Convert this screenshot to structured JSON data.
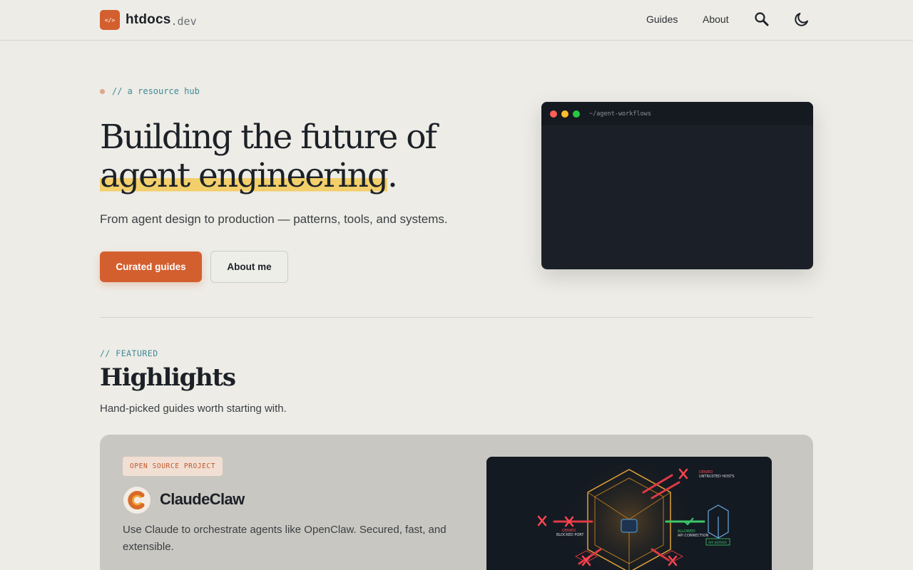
{
  "nav": {
    "logo_icon": "code-brackets-icon",
    "logo_glyph": "</>",
    "site_name": "htdocs",
    "site_tld": ".dev",
    "links": [
      {
        "label": "Guides"
      },
      {
        "label": "About"
      }
    ],
    "icons": [
      "search-icon",
      "moon-icon"
    ]
  },
  "hero": {
    "eyebrow": "// a resource hub",
    "title_line1": "Building the future of",
    "title_highlight": "agent engineering",
    "title_end": ".",
    "subtitle": "From agent design to production — patterns, tools, and systems.",
    "primary_cta": "Curated guides",
    "secondary_cta": "About me",
    "terminal_path": "~/agent-workflows"
  },
  "featured": {
    "eyebrow": "// FEATURED",
    "title": "Highlights",
    "subtitle": "Hand-picked guides worth starting with.",
    "card": {
      "badge": "OPEN SOURCE PROJECT",
      "name": "ClaudeClaw",
      "description": "Use Claude to orchestrate agents like OpenClaw. Secured, fast, and extensible.",
      "image_labels": {
        "denied_hosts_status": "DENIED",
        "denied_hosts": "UNTRUSTED HOSTS",
        "denied_port_status": "DENIED",
        "denied_port": "BLOCKED PORT",
        "allowed_status": "ALLOWED",
        "allowed": "API CONNECTION",
        "server": "API SERVER"
      }
    }
  },
  "colors": {
    "accent": "#d35f2f",
    "highlight": "#f2cf6b",
    "mono_accent": "#3f8a98",
    "background": "#edece6",
    "terminal": "#1b2028"
  }
}
